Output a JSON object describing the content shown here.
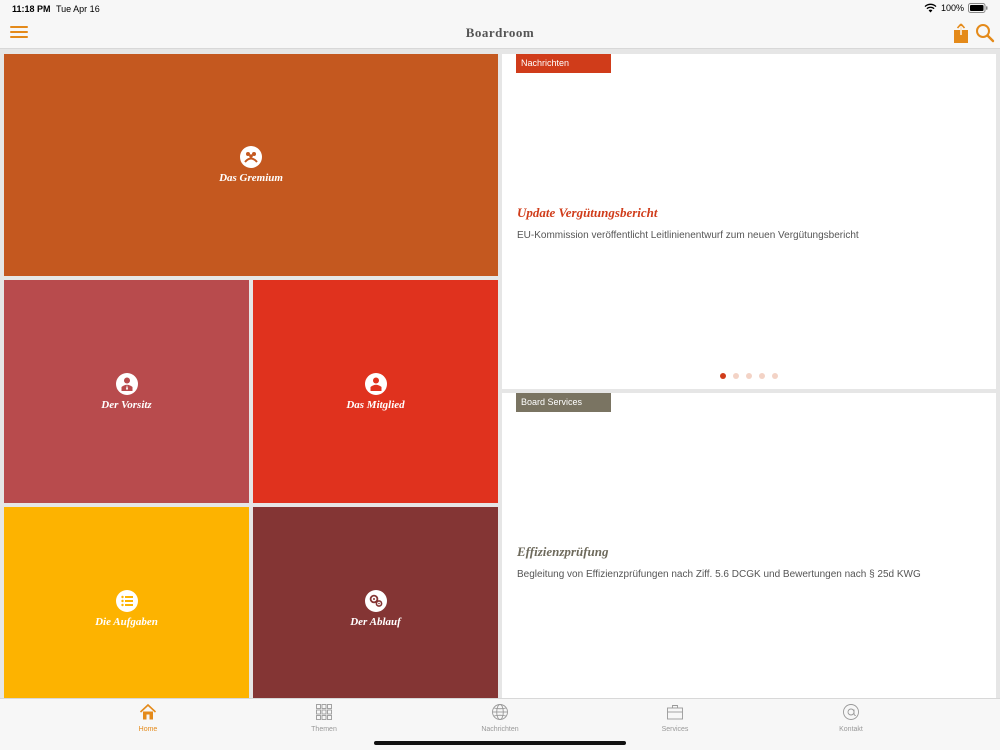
{
  "status_bar": {
    "time": "11:18 PM",
    "date": "Tue Apr 16",
    "battery": "100%"
  },
  "nav": {
    "title": "Boardroom",
    "icons": [
      "hamburger-menu-icon",
      "share-icon",
      "search-icon"
    ]
  },
  "tiles": [
    {
      "label": "Das Gremium",
      "icon": "group-icon",
      "color": "#c4581f"
    },
    {
      "label": "Der Vorsitz",
      "icon": "chairman-icon",
      "color": "#b84b4d"
    },
    {
      "label": "Das Mitglied",
      "icon": "member-icon",
      "color": "#e0321e"
    },
    {
      "label": "Die Aufgaben",
      "icon": "task-list-icon",
      "color": "#fdb300"
    },
    {
      "label": "Der Ablauf",
      "icon": "gears-icon",
      "color": "#843534"
    }
  ],
  "news_card": {
    "tag": "Nachrichten",
    "tag_color": "#d03c1a",
    "title": "Update Vergütungsbericht",
    "title_color": "#d03c1a",
    "description": "EU-Kommission veröffentlicht Leitlinienentwurf zum neuen Vergütungsbericht",
    "pages": 5,
    "active_page": 1
  },
  "services_card": {
    "tag": "Board Services",
    "tag_color": "#7a7462",
    "title": "Effizienzprüfung",
    "title_color": "#6e6a5c",
    "description": "Begleitung von Effizienzprüfungen nach Ziff. 5.6 DCGK und Bewertungen nach § 25d KWG"
  },
  "tabs": [
    {
      "label": "Home",
      "icon": "home-icon",
      "active": true
    },
    {
      "label": "Themen",
      "icon": "grid-icon",
      "active": false
    },
    {
      "label": "Nachrichten",
      "icon": "globe-icon",
      "active": false
    },
    {
      "label": "Services",
      "icon": "briefcase-icon",
      "active": false
    },
    {
      "label": "Kontakt",
      "icon": "at-sign-icon",
      "active": false
    }
  ],
  "colors": {
    "accent": "#e48a1a",
    "inactive_tab": "#999999"
  }
}
